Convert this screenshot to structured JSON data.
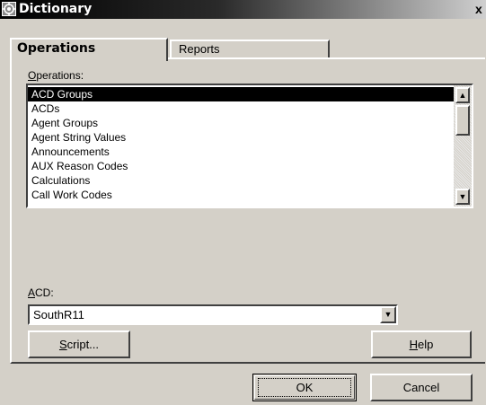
{
  "window": {
    "title": "Dictionary",
    "close_label": "x"
  },
  "tabs": [
    {
      "label": "Operations",
      "active": true
    },
    {
      "label": "Reports",
      "active": false
    }
  ],
  "operations": {
    "label_accel": "O",
    "label_rest": "perations:",
    "items": [
      "ACD Groups",
      "ACDs",
      "Agent Groups",
      "Agent String Values",
      "Announcements",
      "AUX Reason Codes",
      "Calculations",
      "Call Work Codes"
    ],
    "selected_index": 0
  },
  "acd": {
    "label_accel": "A",
    "label_rest": "CD:",
    "value": "SouthR11"
  },
  "buttons": {
    "script_accel": "S",
    "script_rest": "cript...",
    "help_accel": "H",
    "help_rest": "elp",
    "ok": "OK",
    "cancel": "Cancel"
  },
  "icons": {
    "scroll_up": "up-arrow-icon",
    "scroll_down": "down-arrow-icon",
    "dropdown": "chevron-down-icon",
    "app": "dictionary-app-icon"
  },
  "colors": {
    "selection_bg": "#000000",
    "face": "#d4d0c8"
  }
}
